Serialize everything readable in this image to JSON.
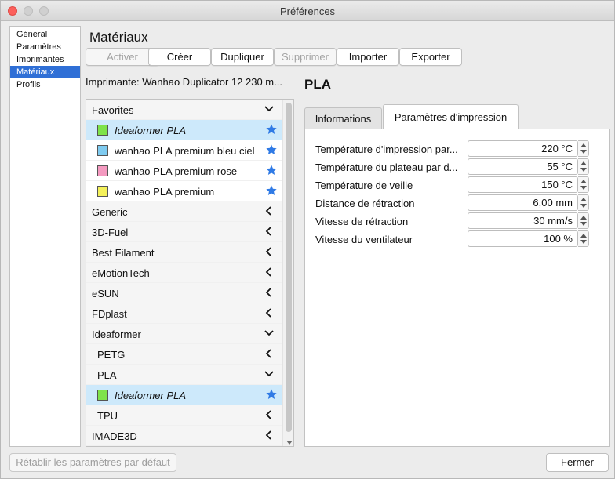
{
  "window": {
    "title": "Préférences"
  },
  "nav": {
    "items": [
      {
        "label": "Général",
        "selected": false
      },
      {
        "label": "Paramètres",
        "selected": false
      },
      {
        "label": "Imprimantes",
        "selected": false
      },
      {
        "label": "Matériaux",
        "selected": true
      },
      {
        "label": "Profils",
        "selected": false
      }
    ]
  },
  "page": {
    "heading": "Matériaux"
  },
  "toolbar": {
    "activate_label": "Activer",
    "create_label": "Créer",
    "duplicate_label": "Dupliquer",
    "delete_label": "Supprimer",
    "import_label": "Importer",
    "export_label": "Exporter"
  },
  "printer_label": "Imprimante: Wanhao Duplicator 12 230 m...",
  "materials": {
    "rows": [
      {
        "label": "Favorites",
        "chevron": "down",
        "type": "category"
      },
      {
        "label": "Ideaformer PLA",
        "type": "fav",
        "swatch": "#7fe34a",
        "starred": true,
        "italic": true,
        "highlight": true
      },
      {
        "label": "wanhao PLA premium bleu ciel",
        "type": "fav",
        "swatch": "#7fcbf0",
        "starred": true
      },
      {
        "label": "wanhao PLA premium rose",
        "type": "fav",
        "swatch": "#f49ac0",
        "starred": true
      },
      {
        "label": "wanhao PLA premium",
        "type": "fav",
        "swatch": "#f4f15a",
        "starred": true
      },
      {
        "label": "Generic",
        "chevron": "left",
        "type": "category"
      },
      {
        "label": "3D-Fuel",
        "chevron": "left",
        "type": "category"
      },
      {
        "label": "Best Filament",
        "chevron": "left",
        "type": "category"
      },
      {
        "label": "eMotionTech",
        "chevron": "left",
        "type": "category"
      },
      {
        "label": "eSUN",
        "chevron": "left",
        "type": "category"
      },
      {
        "label": "FDplast",
        "chevron": "left",
        "type": "category"
      },
      {
        "label": "Ideaformer",
        "chevron": "down",
        "type": "category"
      },
      {
        "label": "PETG",
        "chevron": "left",
        "type": "sub"
      },
      {
        "label": "PLA",
        "chevron": "down",
        "type": "sub"
      },
      {
        "label": "Ideaformer PLA",
        "type": "fav",
        "swatch": "#7fe34a",
        "starred": true,
        "italic": true,
        "highlight": true
      },
      {
        "label": "TPU",
        "chevron": "left",
        "type": "sub"
      },
      {
        "label": "IMADE3D",
        "chevron": "left",
        "type": "category"
      }
    ]
  },
  "material": {
    "name": "PLA"
  },
  "tabs": [
    {
      "label": "Informations",
      "active": false
    },
    {
      "label": "Paramètres d'impression",
      "active": true
    }
  ],
  "print_settings": [
    {
      "label": "Température d'impression par...",
      "value": "220 °C"
    },
    {
      "label": "Température du plateau par d...",
      "value": "55 °C"
    },
    {
      "label": "Température de veille",
      "value": "150 °C"
    },
    {
      "label": "Distance de rétraction",
      "value": "6,00 mm"
    },
    {
      "label": "Vitesse de rétraction",
      "value": "30 mm/s"
    },
    {
      "label": "Vitesse du ventilateur",
      "value": "100 %"
    }
  ],
  "footer": {
    "reset_label": "Rétablir les paramètres par défaut",
    "close_label": "Fermer"
  },
  "colors": {
    "accent": "#2f6fd6",
    "star": "#2f7ae5",
    "highlight_row": "#cde9fb"
  }
}
